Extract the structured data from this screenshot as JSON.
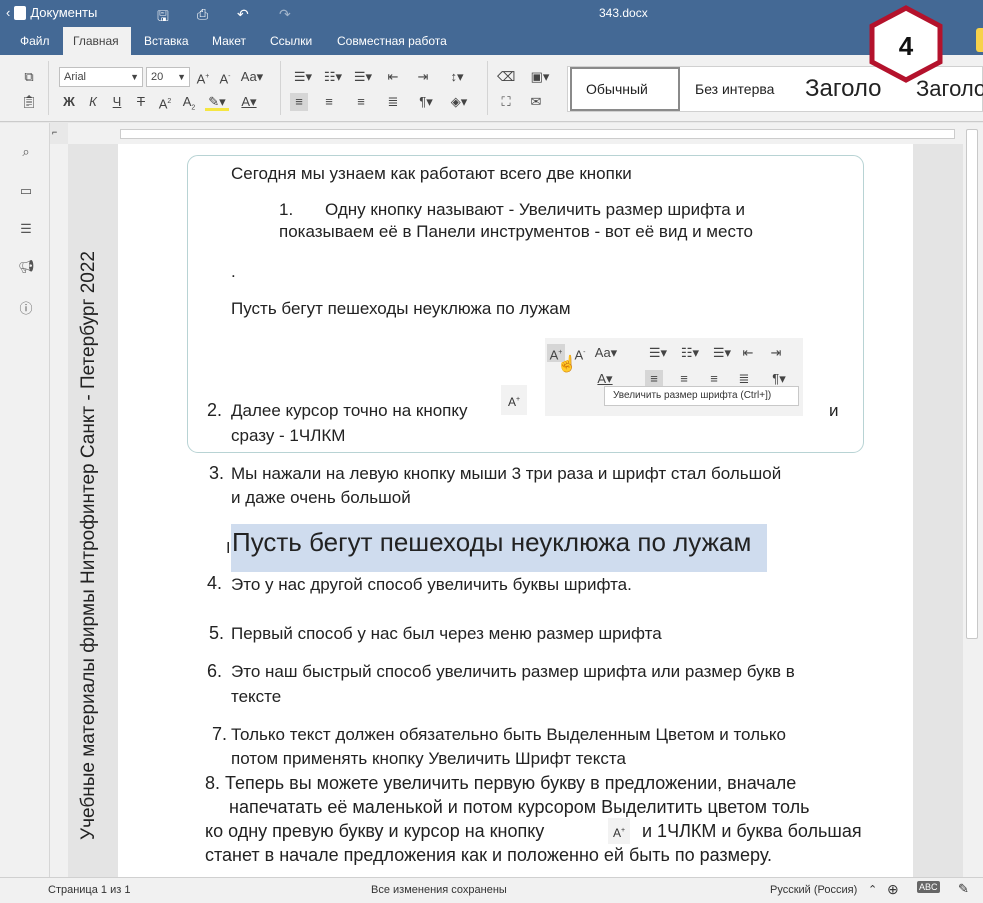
{
  "titlebar": {
    "back_label": "Документы",
    "file_name": "343.docx"
  },
  "tabs": [
    "Файл",
    "Главная",
    "Вставка",
    "Макет",
    "Ссылки",
    "Совместная работа"
  ],
  "toolbar": {
    "font_name": "Arial",
    "font_size": "20",
    "styles": [
      "Обычный",
      "Без интерва",
      "Заголо",
      "Заголо"
    ]
  },
  "badge": {
    "number": "4",
    "color": "#b4122c"
  },
  "vertical_banner": "Учебные материалы фирмы Нитрофинтер  Санкт - Петербург  2022",
  "document": {
    "intro": "Сегодня мы узнаем как работают всего две кнопки",
    "item1_num": "1.",
    "item1_line1": "Одну кнопку называют - Увеличить размер шрифта  и",
    "item1_line2": "показываем её в Панели инструментов - вот её вид и место",
    "dot": ".",
    "sample": "Пусть бегут пешеходы неуклюжа по лужам",
    "item2_num": "2.",
    "item2_line1": "Далее курсор точно на кнопку",
    "item2_and": "и",
    "item2_line2": "сразу - 1ЧЛКМ",
    "tooltip": "Увеличить размер шрифта (Ctrl+])",
    "item3_num": "3.",
    "item3_line1": "Мы нажали на левую кнопку мыши 3 три раза и шрифт стал большой",
    "item3_line2": "и даже очень большой",
    "big_sample": "Пусть бегут пешеходы неуклюжа по лужам",
    "item4_num": "4.",
    "item4_line1": "Это у нас другой способ увеличить буквы шрифта.",
    "item5_num": "5.",
    "item5_line1": "Первый способ у нас был через меню размер шрифта",
    "item6_num": "6.",
    "item6_line1": "Это наш быстрый способ увеличить размер шрифта или размер букв в",
    "item6_line2": "тексте",
    "item7_num": "7.",
    "item7_line1": "Только текст должен обязательно быть Выделенным Цветом и только",
    "item7_line2": "потом применять кнопку Увеличить Шрифт текста",
    "item8_line1": "8. Теперь вы можете увеличить первую букву в предложении, вначале",
    "item8_line2": "напечатать её маленькой и потом курсором Выделитить цветом толь",
    "item8_line3a": "ко одну превую букву и курсор на кнопку",
    "item8_line3b": "и 1ЧЛКМ и буква большая",
    "item8_line4": "станет в начале предложения как и положенно ей быть по размеру."
  },
  "statusbar": {
    "page": "Страница 1 из 1",
    "saved": "Все изменения сохранены",
    "language": "Русский (Россия)"
  },
  "icons": [
    "back-chevron-icon",
    "document-icon",
    "save-icon",
    "print-icon",
    "undo-icon",
    "redo-icon",
    "copy-icon",
    "paste-icon",
    "bold-icon",
    "italic-icon",
    "underline-icon",
    "strikethrough-icon",
    "superscript-icon",
    "subscript-icon",
    "highlight-icon",
    "font-color-icon",
    "increase-font-icon",
    "decrease-font-icon",
    "change-case-icon",
    "bullets-icon",
    "numbering-icon",
    "multilevel-icon",
    "decrease-indent-icon",
    "increase-indent-icon",
    "line-spacing-icon",
    "align-left-icon",
    "align-center-icon",
    "align-right-icon",
    "justify-icon",
    "paragraph-marks-icon",
    "shading-icon",
    "clear-style-icon",
    "fill-icon",
    "format-painter-icon",
    "mail-merge-icon",
    "search-icon",
    "comments-icon",
    "navigation-icon",
    "feedback-icon",
    "about-icon",
    "globe-icon",
    "spellcheck-icon",
    "track-changes-icon"
  ]
}
